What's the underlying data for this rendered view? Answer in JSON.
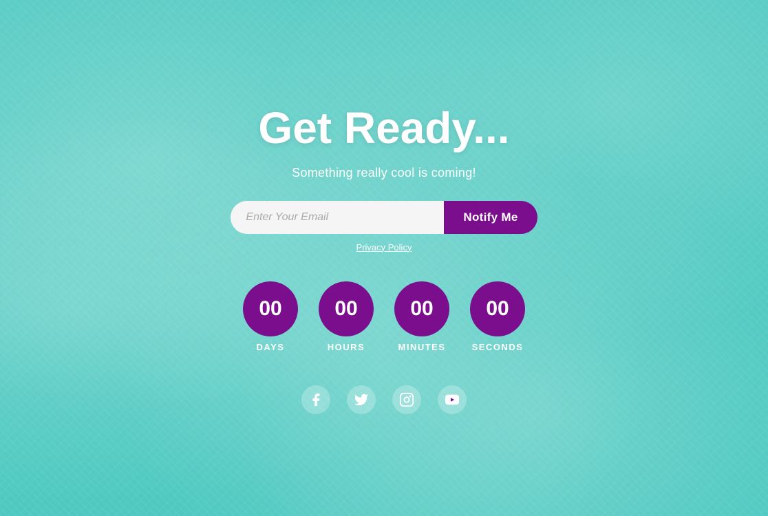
{
  "page": {
    "headline": "Get Ready...",
    "subheadline": "Something really cool is coming!",
    "email_placeholder": "Enter Your Email",
    "notify_button_label": "Notify Me",
    "privacy_label": "Privacy Policy",
    "countdown": {
      "days": {
        "value": "00",
        "label": "DAYS"
      },
      "hours": {
        "value": "00",
        "label": "HOURS"
      },
      "minutes": {
        "value": "00",
        "label": "MINUTES"
      },
      "seconds": {
        "value": "00",
        "label": "SECONDS"
      }
    },
    "social": {
      "facebook": "facebook-icon",
      "twitter": "twitter-icon",
      "instagram": "instagram-icon",
      "youtube": "youtube-icon"
    },
    "colors": {
      "purple": "#7b0e8c",
      "background_teal": "#4ec9c0",
      "white": "#ffffff"
    }
  }
}
